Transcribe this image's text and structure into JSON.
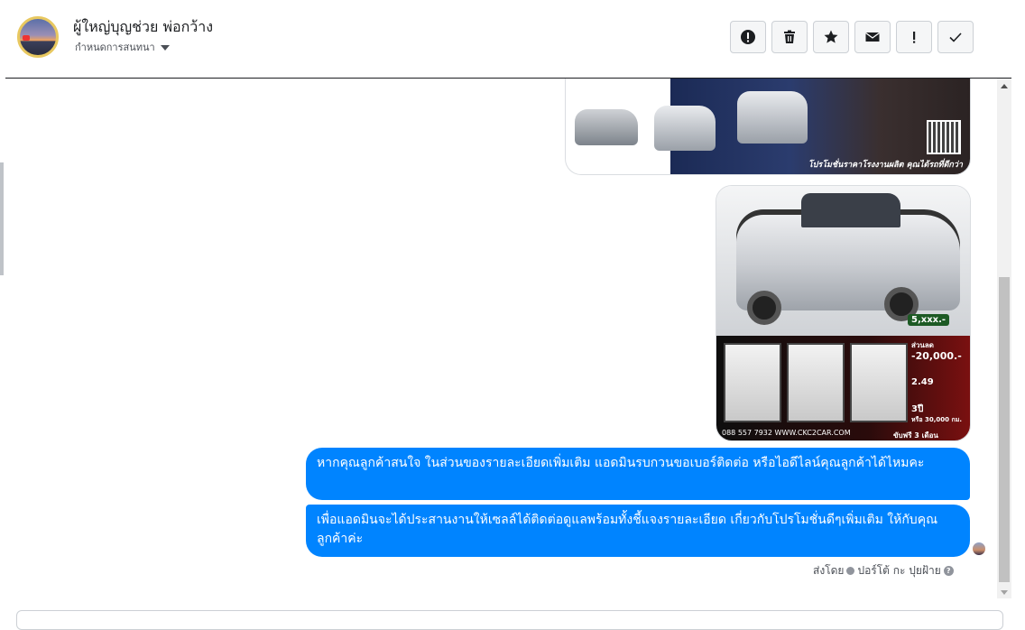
{
  "header": {
    "contact_name": "ผู้ใหญ่บุญช่วย พ่อกว้าง",
    "label_select": "กำหนดการสนทนา"
  },
  "actions": [
    {
      "name": "spam-button",
      "icon": "exclamation-circle-icon"
    },
    {
      "name": "delete-button",
      "icon": "trash-icon"
    },
    {
      "name": "star-button",
      "icon": "star-icon"
    },
    {
      "name": "mark-unread-button",
      "icon": "envelope-icon"
    },
    {
      "name": "follow-up-button",
      "icon": "exclamation-icon"
    },
    {
      "name": "mark-done-button",
      "icon": "check-icon"
    }
  ],
  "thread": {
    "image1": {
      "promo_text": "โปรโมชั่นราคาโรงงานผลิต คุณได้รถที่ดีกว่า"
    },
    "image2": {
      "price_badge": "5,xxx.-",
      "discount_label": "ส่วนลด",
      "discount_value": "-20,000.-",
      "rate_value": "2.49",
      "warranty_value": "3ปี",
      "warranty_note": "หรือ 30,000 กม.",
      "phone_url": "088 557 7932 WWW.CKC2CAR.COM",
      "free_drive": "ขับฟรี 3 เดือน"
    },
    "messages": [
      {
        "text": "หากคุณลูกค้าสนใจ ในส่วนของรายละเอียดเพิ่มเติม แอดมินรบกวนขอเบอร์ติดต่อ หรือไอดีไลน์คุณลูกค้าได้ไหมคะ"
      },
      {
        "text": "เพื่อแอดมินจะได้ประสานงานให้เซลล์ได้ติดต่อดูแลพร้อมทั้งชี้แจงรายละเอียด เกี่ยวกับโปรโมชั่นดีๆเพิ่มเติม ให้กับคุณลูกค้าค่ะ"
      }
    ],
    "sent_by_label": "ส่งโดย",
    "sender_name": "ปอร์โต้ กะ ปุยฝ้าย",
    "help_icon": "?"
  },
  "colors": {
    "bubble": "#0084ff",
    "border": "#ccd0d5"
  }
}
